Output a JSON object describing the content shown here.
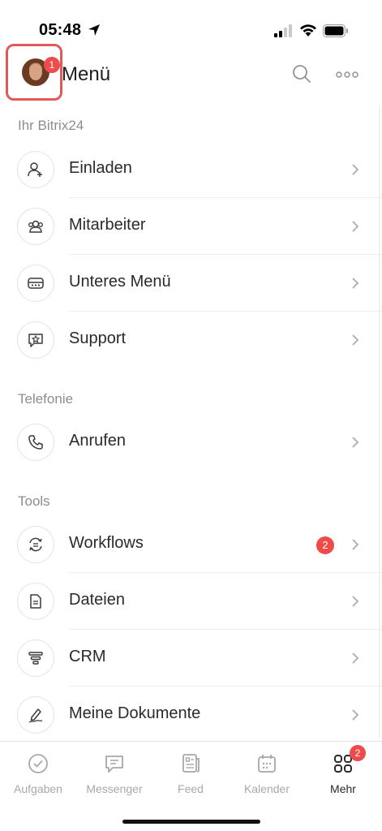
{
  "status_bar": {
    "time": "05:48"
  },
  "header": {
    "title": "Menü",
    "avatar_badge": "1"
  },
  "sections": {
    "bitrix": {
      "label": "Ihr Bitrix24",
      "items": [
        {
          "label": "Einladen",
          "icon": "add-user-icon"
        },
        {
          "label": "Mitarbeiter",
          "icon": "employees-icon"
        },
        {
          "label": "Unteres Menü",
          "icon": "bottom-menu-icon"
        },
        {
          "label": "Support",
          "icon": "support-icon"
        }
      ]
    },
    "telefonie": {
      "label": "Telefonie",
      "items": [
        {
          "label": "Anrufen",
          "icon": "phone-icon"
        }
      ]
    },
    "tools": {
      "label": "Tools",
      "items": [
        {
          "label": "Workflows",
          "icon": "workflows-icon",
          "badge": "2"
        },
        {
          "label": "Dateien",
          "icon": "file-icon"
        },
        {
          "label": "CRM",
          "icon": "crm-funnel-icon"
        },
        {
          "label": "Meine Dokumente",
          "icon": "signature-pen-icon"
        }
      ]
    }
  },
  "tab_bar": {
    "tabs": [
      {
        "label": "Aufgaben",
        "icon": "check-circle-icon"
      },
      {
        "label": "Messenger",
        "icon": "chat-icon"
      },
      {
        "label": "Feed",
        "icon": "feed-icon"
      },
      {
        "label": "Kalender",
        "icon": "calendar-icon"
      },
      {
        "label": "Mehr",
        "icon": "grid-more-icon",
        "badge": "2",
        "active": true
      }
    ]
  },
  "colors": {
    "badge": "#ef4b4b",
    "highlight_frame": "#e05a5a",
    "muted_text": "#8a8d93",
    "active_tab": "#2a2a2a"
  }
}
